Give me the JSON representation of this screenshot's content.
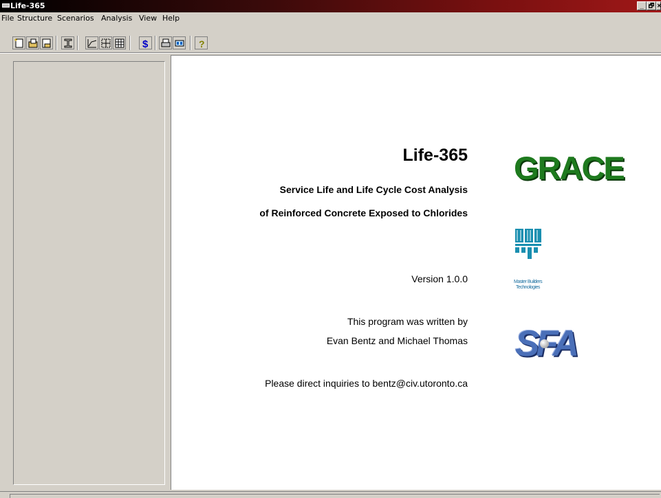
{
  "window": {
    "title": "Life-365",
    "controls": {
      "minimize": "_",
      "restore": "🗗",
      "close": "✕"
    }
  },
  "menu": [
    "File",
    "Structure",
    "Scenarios",
    "Analysis",
    "View",
    "Help"
  ],
  "toolbar": {
    "buttons": [
      "new-icon",
      "open-icon",
      "save-icon",
      "structure-icon",
      "chart-icon",
      "grid-icon",
      "table-icon",
      "cost-icon",
      "print-icon",
      "report-icon",
      "help-icon"
    ]
  },
  "splash": {
    "title": "Life-365",
    "subtitle_line1": "Service Life and Life Cycle Cost Analysis",
    "subtitle_line2": "of Reinforced Concrete Exposed to Chlorides",
    "version": "Version 1.0.0",
    "author_line1": "This program was written by",
    "author_line2": "Evan Bentz and Michael Thomas",
    "contact": "Please direct inquiries to bentz@civ.utoronto.ca"
  },
  "logos": {
    "grace": "GRACE",
    "mb_line1": "Master Builders",
    "mb_line2": "Technologies",
    "sfa": "SFA"
  },
  "colors": {
    "grace_green": "#1e7a1e",
    "mb_teal": "#1a8fb0",
    "sfa_blue": "#4a6fb8"
  }
}
